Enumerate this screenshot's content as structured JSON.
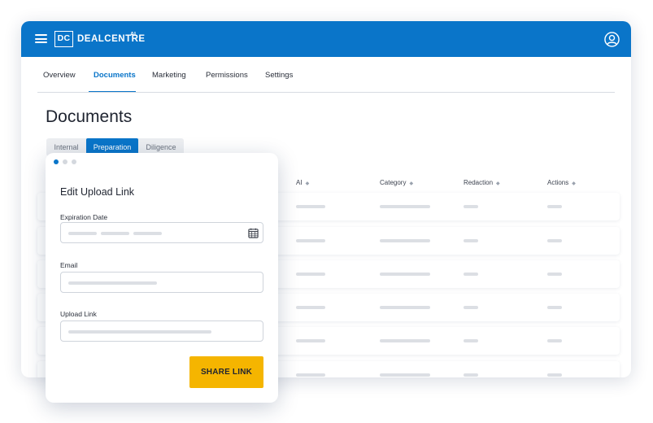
{
  "app": {
    "logo_mark": "DC",
    "logo_name": "DEALCENTRE",
    "logo_sup": "AI"
  },
  "icons": {
    "menu": "hamburger-icon",
    "user": "user-circle-icon",
    "calendar": "calendar-icon",
    "sort": "sort-icon"
  },
  "colors": {
    "brand": "#0a75c9",
    "accent_button": "#f5b500",
    "placeholder": "#dcdfe4"
  },
  "nav": {
    "tabs": [
      {
        "label": "Overview",
        "active": false
      },
      {
        "label": "Documents",
        "active": true
      },
      {
        "label": "Marketing",
        "active": false
      },
      {
        "label": "Permissions",
        "active": false
      },
      {
        "label": "Settings",
        "active": false
      }
    ]
  },
  "page": {
    "title": "Documents"
  },
  "segments": [
    {
      "label": "Internal",
      "active": false
    },
    {
      "label": "Preparation",
      "active": true
    },
    {
      "label": "Diligence",
      "active": false
    }
  ],
  "table": {
    "columns": [
      "AI",
      "Category",
      "Redaction",
      "Actions"
    ],
    "sort_glyph": "◆"
  },
  "modal": {
    "title": "Edit Upload Link",
    "step_count": 3,
    "active_step": 1,
    "fields": {
      "expiration_label": "Expiration Date",
      "email_label": "Email",
      "upload_link_label": "Upload Link"
    },
    "submit_label": "SHARE LINK"
  }
}
